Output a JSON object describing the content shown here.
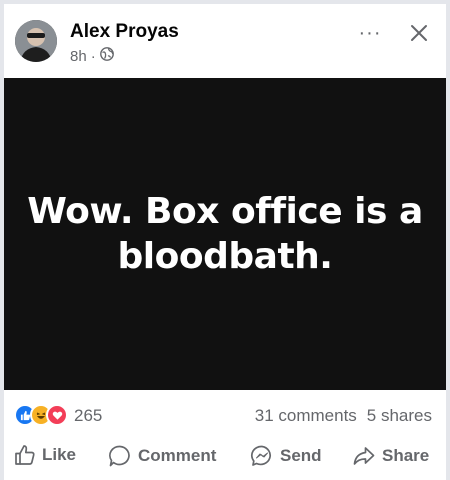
{
  "post": {
    "author": "Alex Proyas",
    "time": "8h",
    "separator": "·",
    "privacy_icon": "globe-icon",
    "more_icon": "more-icon",
    "more_glyph": "···",
    "close_icon": "close-icon",
    "image_text": "Wow. Box office is a bloodbath."
  },
  "stats": {
    "reaction_icons": [
      "like-reaction-icon",
      "haha-reaction-icon",
      "love-reaction-icon"
    ],
    "reaction_count": "265",
    "comments": "31 comments",
    "shares": "5 shares"
  },
  "actions": {
    "like": "Like",
    "comment": "Comment",
    "send": "Send",
    "share": "Share"
  },
  "colors": {
    "image_background": "#111111",
    "secondary_text": "#65676b",
    "like_blue": "#1877f2",
    "love_red": "#f33e58",
    "haha_yellow": "#f7b125"
  }
}
